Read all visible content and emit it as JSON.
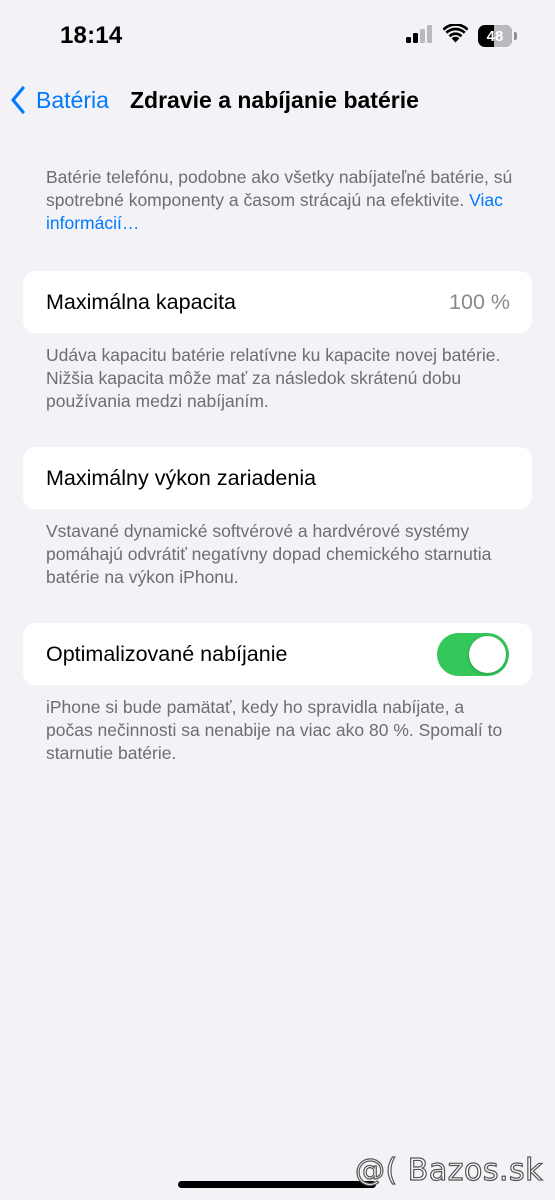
{
  "status_bar": {
    "time": "18:14",
    "battery_level": "48",
    "battery_fraction": 0.48,
    "icons": [
      "cellular-signal-icon",
      "wifi-icon",
      "battery-icon"
    ]
  },
  "nav": {
    "back_label": "Batéria",
    "title": "Zdravie a nabíjanie batérie"
  },
  "intro": {
    "text": "Batérie telefónu, podobne ako všetky nabíjateľné batérie, sú spotrebné komponenty a časom strácajú na efektivite.",
    "link": "Viac informácií…"
  },
  "max_capacity": {
    "label": "Maximálna kapacita",
    "value": "100 %",
    "footer": "Udáva kapacitu batérie relatívne ku kapacite novej batérie. Nižšia kapacita môže mať za následok skrátenú dobu používania medzi nabíjaním."
  },
  "peak_performance": {
    "label": "Maximálny výkon zariadenia",
    "footer": "Vstavané dynamické softvérové a hardvérové systémy pomáhajú odvrátiť negatívny dopad chemického starnutia batérie na výkon iPhonu."
  },
  "optimized_charging": {
    "label": "Optimalizované nabíjanie",
    "enabled": true,
    "footer": "iPhone si bude pamätať, kedy ho spravidla nabíjate, a počas nečinnosti sa nenabije na viac ako 80 %. Spomalí to starnutie batérie."
  },
  "watermark": "@( Bazos.sk",
  "colors": {
    "accent": "#007aff",
    "toggle_on": "#34c759",
    "background": "#f2f2f7",
    "secondary_text": "#6d6d72"
  }
}
